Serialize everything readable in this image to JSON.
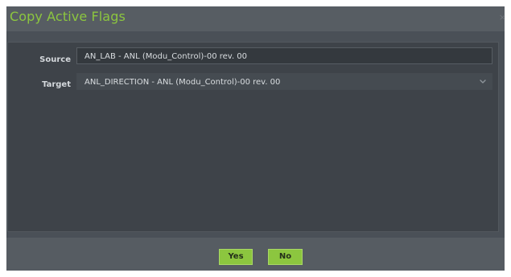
{
  "dialog": {
    "title": "Copy Active Flags",
    "close_glyph": "×"
  },
  "form": {
    "source_label": "Source",
    "source_value": "AN_LAB - ANL (Modu_Control)-00 rev. 00",
    "target_label": "Target",
    "target_value": "ANL_DIRECTION - ANL (Modu_Control)-00 rev. 00"
  },
  "buttons": {
    "yes_label": "Yes",
    "no_label": "No"
  },
  "colors": {
    "accent": "#8cc63f",
    "dialog_background": "#4a5057",
    "panel_background": "#3e4349"
  },
  "icons": {
    "close": "close-icon",
    "dropdown": "chevron-down-icon"
  }
}
